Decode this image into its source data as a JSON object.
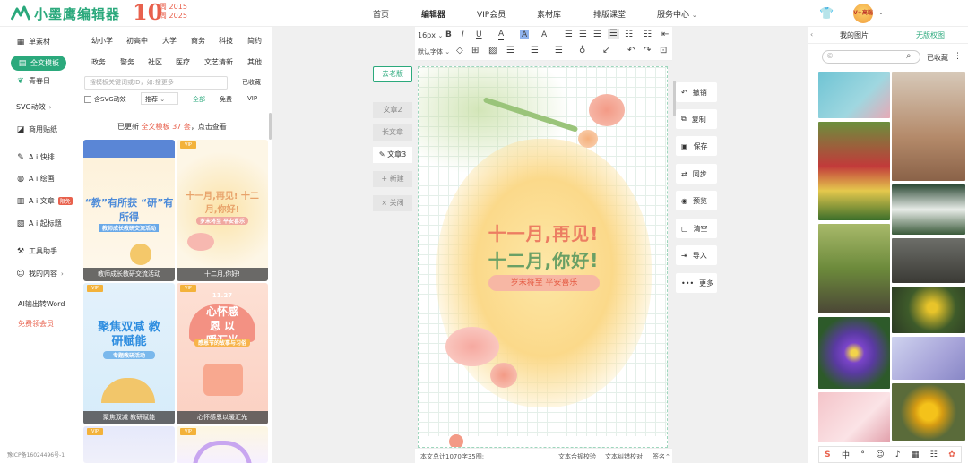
{
  "header": {
    "logo_text": "小墨鹰编辑器",
    "anniv_number": "10",
    "anniv_char": "周",
    "anniv_years": [
      "2015",
      "2025"
    ],
    "nav": [
      {
        "label": "首页",
        "active": false
      },
      {
        "label": "编辑器",
        "active": true
      },
      {
        "label": "VIP会员",
        "active": false
      },
      {
        "label": "素材库",
        "active": false
      },
      {
        "label": "排版课堂",
        "active": false
      },
      {
        "label": "服务中心",
        "active": false
      }
    ],
    "avatar_text": "V+高端"
  },
  "left_nav": {
    "items": [
      {
        "label": "单素材",
        "icon": "grid-icon"
      },
      {
        "label": "全文模板",
        "icon": "template-icon",
        "active": true
      },
      {
        "label": "青春日",
        "icon": "leaf-icon"
      },
      {
        "label": "SVG动效",
        "icon": "svg-icon"
      },
      {
        "label": "商用贴纸",
        "icon": "sticker-icon"
      },
      {
        "label": "A i 快排",
        "icon": "ai-icon"
      },
      {
        "label": "A i 绘画",
        "icon": "palette-icon"
      },
      {
        "label": "A i 文章",
        "icon": "doc-icon",
        "badge": "限免"
      },
      {
        "label": "A i 起标题",
        "icon": "title-icon"
      },
      {
        "label": "工具助手",
        "icon": "tool-icon"
      },
      {
        "label": "我的内容",
        "icon": "user-icon"
      },
      {
        "label": "AI输出转Word"
      },
      {
        "label": "免费领会员"
      }
    ],
    "icp": "豫ICP备16024496号-1"
  },
  "templates": {
    "categories_row1": [
      "幼小学",
      "初高中",
      "大学",
      "商务",
      "科技",
      "简约"
    ],
    "categories_row2": [
      "政务",
      "警务",
      "社区",
      "医疗",
      "文艺清新",
      "其他"
    ],
    "search_placeholder": "搜模板关键词或ID，如:搜更多",
    "collect_label": "已收藏",
    "svg_check": "含SVG动效",
    "sort": "推荐",
    "filters": [
      "全部",
      "免费",
      "VIP"
    ],
    "update_prefix": "已更新",
    "update_highlight": "全文模板 37 套",
    "update_suffix": "，点击查看",
    "cards": [
      {
        "caption": "教师成长教研交流活动",
        "title": "“教”有所获 “研”有所得",
        "sub": "教师成长教研交流活动"
      },
      {
        "caption": "十二月,你好!",
        "title": "十一月,再见! 十二月,你好!",
        "sub": "岁末将至 平安喜乐"
      },
      {
        "caption": "聚焦双减 教研赋能",
        "title": "聚焦双减 教研赋能",
        "sub": "专题教研活动"
      },
      {
        "caption": "心怀感恩以暖汇光",
        "title": "心怀感恩 以暖汇光",
        "sub": "感恩节的故事与习俗",
        "date": "11.27"
      }
    ],
    "vip_label": "VIP"
  },
  "tabs_left": {
    "old_version": "去老版",
    "items": [
      "文章2",
      "长文章",
      "文章3",
      "新建",
      "关闭"
    ]
  },
  "toolbar": {
    "font_size": "16px",
    "font_family": "默认字体",
    "row1": [
      "B",
      "I",
      "U"
    ]
  },
  "canvas": {
    "line1": "十一月,再见!",
    "line2": "十二月,你好!",
    "ribbon": "岁末将至 平安喜乐"
  },
  "status_bar": {
    "count": "本文总计1070字35图;",
    "check": "文本合规校验",
    "proof": "文本纠错校对",
    "sign": "签名"
  },
  "actions": [
    {
      "label": "撤销",
      "icon": "undo-icon",
      "glyph": "↶"
    },
    {
      "label": "复制",
      "icon": "copy-icon",
      "glyph": "⧉"
    },
    {
      "label": "保存",
      "icon": "save-icon",
      "glyph": "▣"
    },
    {
      "label": "同步",
      "icon": "sync-icon",
      "glyph": "⇄"
    },
    {
      "label": "预览",
      "icon": "eye-icon",
      "glyph": "◉"
    },
    {
      "label": "清空",
      "icon": "trash-icon",
      "glyph": "▢"
    },
    {
      "label": "导入",
      "icon": "import-icon",
      "glyph": "⇥"
    },
    {
      "label": "更多",
      "icon": "more-icon",
      "glyph": "•••"
    }
  ],
  "right_panel": {
    "tab_images": "我的图片",
    "tab_free": "无版权图",
    "collect": "已收藏",
    "ime": [
      "S",
      "中",
      "°",
      "☺",
      "♪",
      "▦",
      "☷",
      "✿"
    ]
  },
  "colors": {
    "accent": "#2ba97c",
    "brand_red": "#e8614d",
    "orange": "#f3b23a"
  }
}
